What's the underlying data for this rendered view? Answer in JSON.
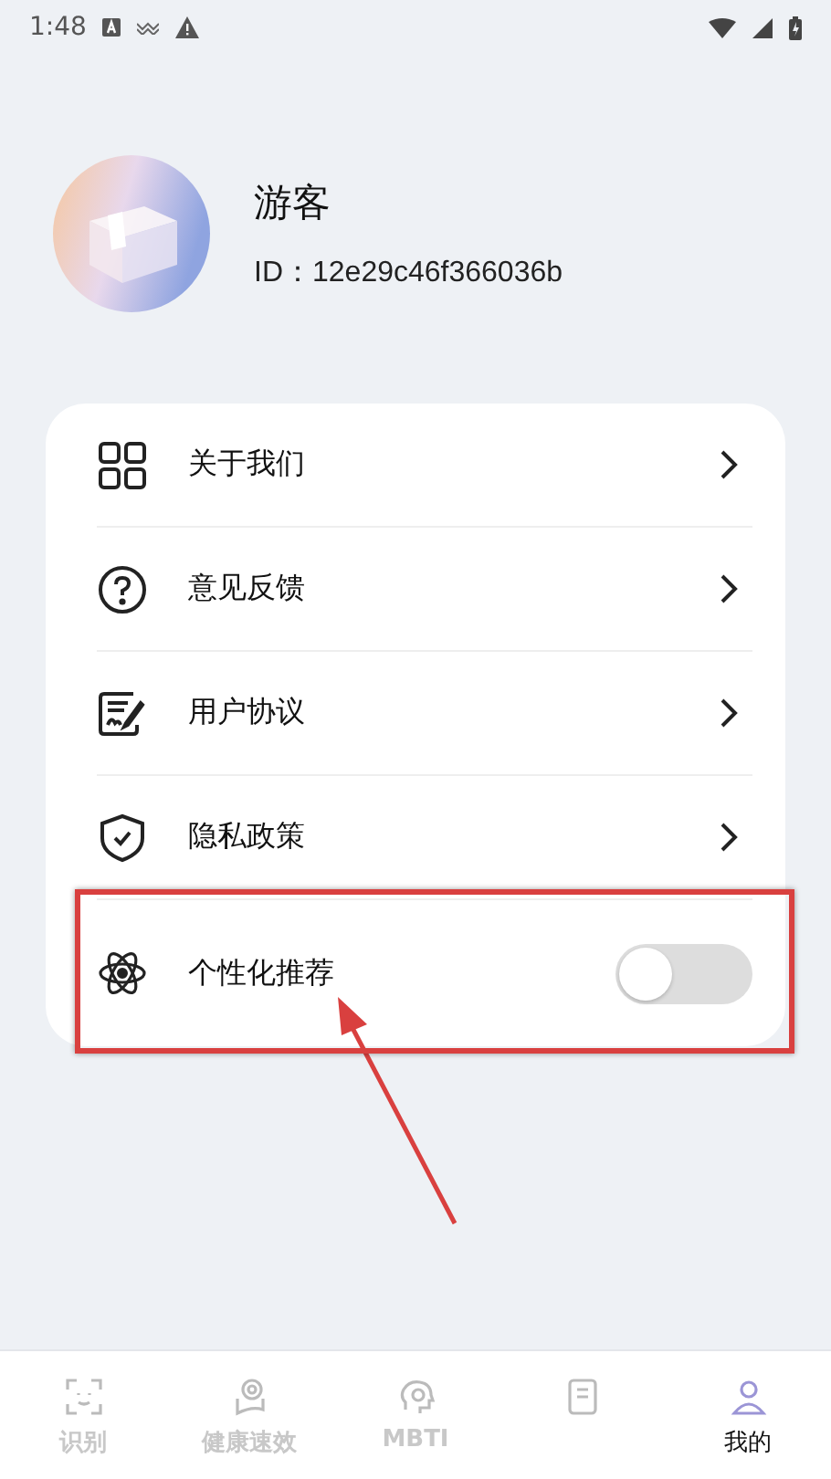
{
  "status_bar": {
    "time": "1:48"
  },
  "profile": {
    "name": "游客",
    "id": "ID：12e29c46f366036b"
  },
  "menu": [
    {
      "kind": "link",
      "label": "关于我们",
      "highlighted": false
    },
    {
      "kind": "link",
      "label": "意见反馈",
      "highlighted": false
    },
    {
      "kind": "link",
      "label": "用户协议",
      "highlighted": false
    },
    {
      "kind": "link",
      "label": "隐私政策",
      "highlighted": false
    },
    {
      "kind": "toggle",
      "label": "个性化推荐",
      "on": false,
      "highlighted": true
    }
  ],
  "bottom_nav": [
    {
      "label": "识别",
      "selected": false
    },
    {
      "label": "健康速效",
      "selected": false
    },
    {
      "label": "MBTI",
      "selected": false
    },
    {
      "selected": false
    },
    {
      "label": "我的",
      "selected": true
    }
  ]
}
